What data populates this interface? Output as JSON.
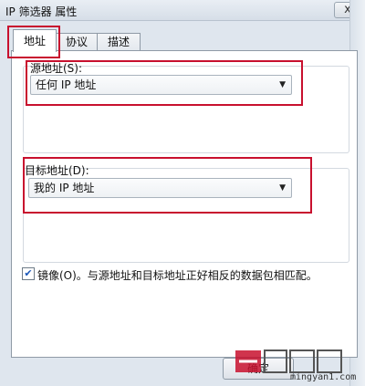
{
  "window": {
    "title": "IP 筛选器 属性",
    "close_glyph": "x"
  },
  "tabs": [
    {
      "label": "地址",
      "active": true
    },
    {
      "label": "协议",
      "active": false
    },
    {
      "label": "描述",
      "active": false
    }
  ],
  "source": {
    "label": "源地址(S):",
    "value": "任何 IP 地址"
  },
  "destination": {
    "label": "目标地址(D):",
    "value": "我的 IP 地址"
  },
  "mirror": {
    "checked": true,
    "label": "镜像(O)。与源地址和目标地址正好相反的数据包相匹配。"
  },
  "buttons": {
    "ok": "确定"
  },
  "watermark": {
    "logo_text": "产西龙网",
    "url": "mingyan1.com"
  },
  "colors": {
    "highlight": "#c8102e",
    "tab_border": "#8f9aa6"
  },
  "icons": {
    "dropdown": "chevron-down-icon",
    "check": "check-icon"
  }
}
